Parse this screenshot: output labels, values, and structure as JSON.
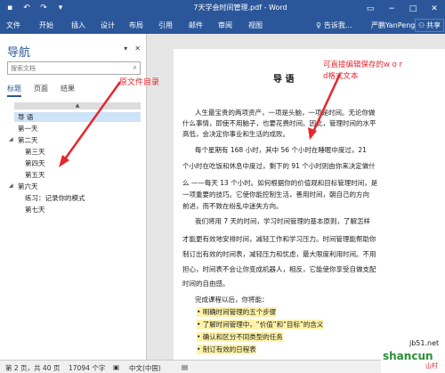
{
  "titlebar": {
    "title": "7天学会时间管理.pdf - Word",
    "qat": {
      "save_icon": "save-icon",
      "undo_icon": "undo-icon",
      "redo_icon": "redo-icon",
      "customize_icon": "customize-icon"
    },
    "controls": {
      "ribbon_display": "ribbon-display-icon",
      "minimize": "minimize-icon",
      "maximize": "maximize-icon",
      "close": "close-icon"
    }
  },
  "ribbon": {
    "tabs": [
      "文件",
      "开始",
      "插入",
      "设计",
      "布局",
      "引用",
      "邮件",
      "审阅",
      "视图"
    ],
    "tell_me": "告诉我...",
    "user": "严鹏YanPeng",
    "share": "共享"
  },
  "nav": {
    "title": "导航",
    "search_placeholder": "搜索文档",
    "tabs": [
      "标题",
      "页面",
      "结果"
    ],
    "items": [
      {
        "label": "导 语"
      },
      {
        "label": "第一天"
      },
      {
        "label": "第二天"
      },
      {
        "label": "第三天"
      },
      {
        "label": "第四天"
      },
      {
        "label": "第五天"
      },
      {
        "label": "第六天"
      },
      {
        "label": "练习：记录你的模式"
      },
      {
        "label": "第七天"
      }
    ]
  },
  "annotations": {
    "left": "原文件目录",
    "right_line1": "可直接编辑保存的w o r",
    "right_line2": "d格式文本"
  },
  "document": {
    "heading": "导 语",
    "lines": [
      "人生最宝贵的两项资产，一项是头脑，一项是时间。无论你做",
      "什么事情，即使不用脑子，也要花费时间。因此，管理时间的水平",
      "高低，会决定你事业和生活的成败。",
      "每个星期有 168 小时，其中 56 个小时在睡眠中度过，21",
      "个小时在吃饭和休息中度过，剩下的 91 个小时则由你来决定做什",
      "么 ——每天 13 个小时。如何根据你的价值观和目标管理时间，是",
      "一项重要的技巧。它使你能控制生活，善用时间，朝自己的方向",
      "前进，而不致在纷乱中迷失方向。",
      "我们将用 7 天的时间，学习时间管理的基本原则，了解怎样",
      "才能更有效地安排时间，减轻工作和学习压力。时间管理能帮助你",
      "制订出有效的时间表，减轻压力和忧虑，最大限度利用时间。不用",
      "担心，时间表不会让你变成机器人，相反，它能使你享受自做支配",
      "时间的自由感。",
      "完成课程以后，你将能：",
      "• 明确时间管理的五个步骤",
      "• 了解时间管理中，“价值”和“目标”的含义",
      "• 确认和区分不同类型的任务",
      "• 制订有效的日程表"
    ]
  },
  "status": {
    "page": "第 2 页，共 40 页",
    "words": "17094 个字",
    "proof_icon": "proofing-icon",
    "lang": "中文(中国)",
    "view_icon": "read-mode-icon"
  },
  "watermark": {
    "top": "jb51.net",
    "main": "shancun",
    "sub": "山村"
  },
  "colors": {
    "accent": "#2b579a",
    "annotation": "#e8262c",
    "highlight": "#fff3a8"
  }
}
